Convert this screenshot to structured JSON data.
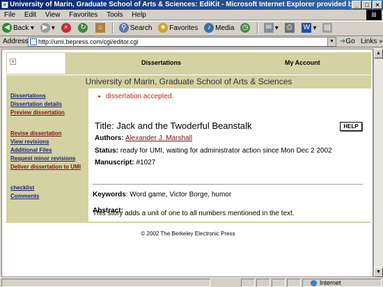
{
  "window": {
    "title": "University of Marin, Graduate School of Arts & Sciences: EdiKit - Microsoft Internet Explorer provided by ProQuest Enterprise S",
    "buttons": [
      "_",
      "□",
      "×"
    ]
  },
  "menu": [
    "File",
    "Edit",
    "View",
    "Favorites",
    "Tools",
    "Help"
  ],
  "toolbar": {
    "back": "Back",
    "search": "Search",
    "favorites": "Favorites",
    "media": "Media"
  },
  "address": {
    "label": "Address",
    "url": "http://umi.bepress.com/cgi/editor.cgi",
    "go": "Go",
    "links": "Links"
  },
  "page": {
    "nav": {
      "dissertations": "Dissertations",
      "my_account": "My Account"
    },
    "school": "University of Marin, Graduate School of Arts & Sciences",
    "sidebar": {
      "group1": [
        "Dissertations",
        "Dissertation details",
        "Preview dissertation"
      ],
      "group2": [
        "Revise dissertation",
        "View revisions",
        "Additional Files",
        "Request minor revisions",
        "Deliver dissertation to UMI"
      ],
      "group3": [
        "checklist",
        "Comments"
      ]
    },
    "message": "dissertation accepted.",
    "title_label": "Title:",
    "title": "Jack and the Twoderful Beanstalk",
    "help": "HELP",
    "authors_label": "Authors:",
    "author": "Alexander J. Marshall",
    "status_label": "Status:",
    "status": "ready for UMI, waiting for administrator action since Mon Dec 2 2002",
    "manuscript_label": "Manuscript:",
    "manuscript": "#1027",
    "keywords_label": "Keywords",
    "keywords": "Word game, Victor Borge, humor",
    "abstract_label": "Abstract:",
    "abstract": "This story adds a unit of one to all numbers mentioned in the text.",
    "footer": "© 2002 The Berkeley Electronic Press"
  },
  "status": {
    "zone": "Internet"
  }
}
